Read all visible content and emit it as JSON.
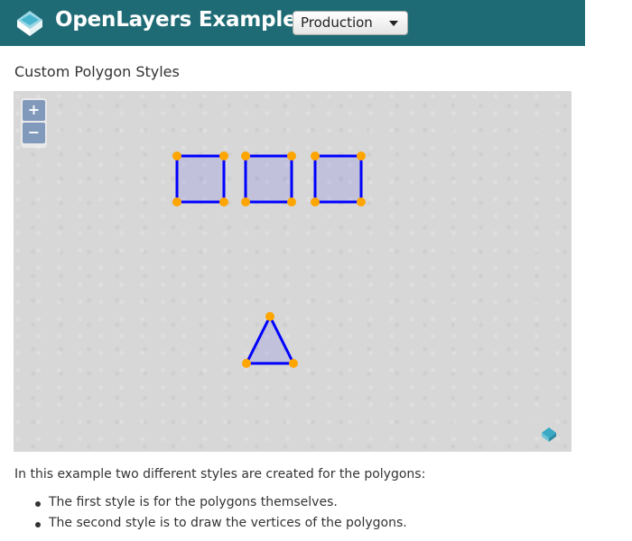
{
  "header": {
    "title": "OpenLayers Examples",
    "version_selected": "Production",
    "logo_icon": "openlayers-logo-icon",
    "colors": {
      "bar": "#1f6b75"
    }
  },
  "example": {
    "title": "Custom Polygon Styles"
  },
  "map": {
    "zoom_in_label": "+",
    "zoom_out_label": "−",
    "attribution_icon": "openlayers-logo-icon",
    "polygon_style": {
      "stroke": "#0000ff",
      "fill": "rgba(0,0,255,0.1)",
      "vertex": "#ffa500"
    },
    "features": [
      {
        "type": "square"
      },
      {
        "type": "square"
      },
      {
        "type": "square"
      },
      {
        "type": "triangle"
      }
    ]
  },
  "description": {
    "intro": "In this example two different styles are created for the polygons:",
    "bullets": [
      "The first style is for the polygons themselves.",
      "The second style is to draw the vertices of the polygons."
    ]
  }
}
